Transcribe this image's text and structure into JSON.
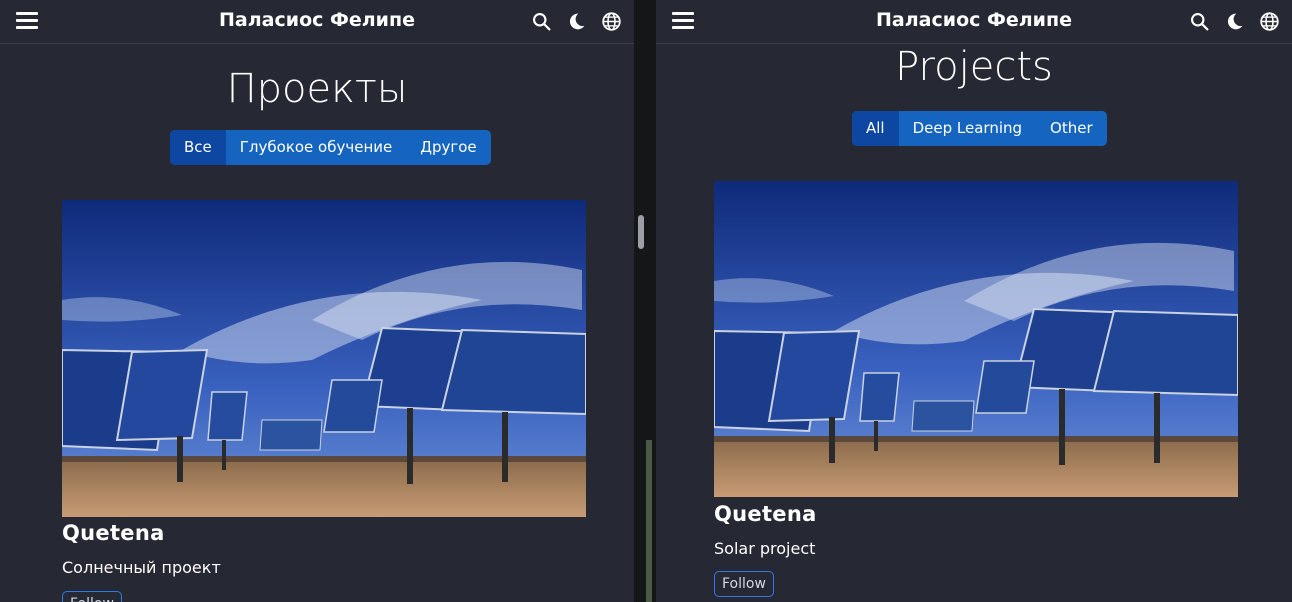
{
  "left_pane": {
    "site_title": "Паласиос Фелипе",
    "page_heading": "Проекты",
    "filter_tabs": [
      "Все",
      "Глубокое обучение",
      "Другое"
    ],
    "card": {
      "title": "Quetena",
      "description": "Солнечный проект",
      "follow_label": "Follow"
    }
  },
  "right_pane": {
    "site_title": "Паласиос Фелипе",
    "page_heading": "Projects",
    "filter_tabs": [
      "All",
      "Deep Learning",
      "Other"
    ],
    "card": {
      "title": "Quetena",
      "description": "Solar project",
      "follow_label": "Follow"
    }
  },
  "icons": [
    "menu-icon",
    "search-icon",
    "moon-icon",
    "globe-icon"
  ],
  "colors": {
    "background": "#262833",
    "tab_bar": "#1565c0",
    "tab_active": "#0d47a1",
    "follow_border": "#2f7ae5",
    "text": "#ffffff"
  }
}
